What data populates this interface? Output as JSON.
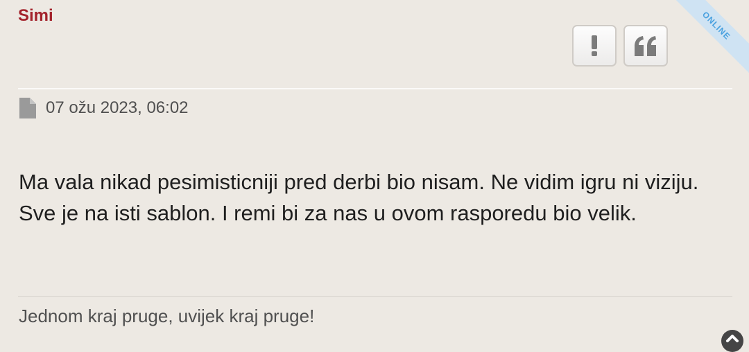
{
  "post": {
    "author": "Simi",
    "online_badge": "ONLINE",
    "date": "07 ožu 2023, 06:02",
    "content": "Ma vala nikad pesimisticniji pred derbi bio nisam. Ne vidim igru ni viziju. Sve je na isti sablon. I remi bi za nas u ovom rasporedu bio velik.",
    "signature": "Jednom kraj pruge, uvijek kraj pruge!"
  },
  "actions": {
    "report_icon": "exclamation-icon",
    "quote_icon": "quote-icon"
  },
  "colors": {
    "author": "#a3222b",
    "background": "#ede9e3",
    "online_badge_text": "#4aa1df",
    "online_badge_bg": "#cfe3f3"
  },
  "icons": {
    "date": "file-icon",
    "scroll": "chevron-up-icon"
  }
}
